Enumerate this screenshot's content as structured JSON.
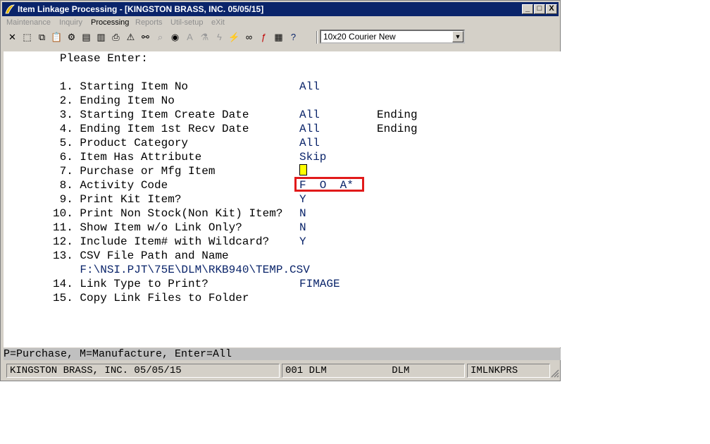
{
  "window": {
    "title": "Item Linkage Processing - [KINGSTON BRASS, INC. 05/05/15]",
    "controls": [
      "_",
      "□",
      "X"
    ]
  },
  "menu": [
    {
      "label": "Maintenance",
      "active": false
    },
    {
      "label": "Inquiry",
      "active": false
    },
    {
      "label": "Processing",
      "active": true
    },
    {
      "label": "Reports",
      "active": false
    },
    {
      "label": "Util-setup",
      "active": false
    },
    {
      "label": "eXit",
      "active": false
    }
  ],
  "toolbar": {
    "icons": [
      {
        "name": "close-icon",
        "glyph": "✕"
      },
      {
        "name": "select-icon",
        "glyph": "⬚"
      },
      {
        "name": "copy-icon",
        "glyph": "⧉"
      },
      {
        "name": "paste-icon",
        "glyph": "📋"
      },
      {
        "name": "gear-icon",
        "glyph": "⚙"
      },
      {
        "name": "print-setup-icon",
        "glyph": "▤"
      },
      {
        "name": "document-icon",
        "glyph": "▥"
      },
      {
        "name": "printer-icon",
        "glyph": "⎙"
      },
      {
        "name": "warning-icon",
        "glyph": "⚠"
      },
      {
        "name": "binoculars-icon",
        "glyph": "⚯"
      },
      {
        "name": "magnifier-icon",
        "glyph": "⌕"
      },
      {
        "name": "globe-icon",
        "glyph": "◉"
      },
      {
        "name": "font-icon",
        "glyph": "A"
      },
      {
        "name": "wizard-icon",
        "glyph": "⚗"
      },
      {
        "name": "lightning-icon",
        "glyph": "ϟ"
      },
      {
        "name": "macro-icon",
        "glyph": "⚡"
      },
      {
        "name": "link-icon",
        "glyph": "∞"
      },
      {
        "name": "function-icon",
        "glyph": "ƒ"
      },
      {
        "name": "calculator-icon",
        "glyph": "▦"
      },
      {
        "name": "help-icon",
        "glyph": "?"
      }
    ],
    "font_selector": "10x20 Courier New"
  },
  "form": {
    "heading": "Please Enter:",
    "items": [
      {
        "label": " 1. Starting Item No",
        "value": "All",
        "extra": ""
      },
      {
        "label": " 2. Ending Item No",
        "value": "",
        "extra": ""
      },
      {
        "label": " 3. Starting Item Create Date",
        "value": "All",
        "extra": "Ending"
      },
      {
        "label": " 4. Ending Item 1st Recv Date",
        "value": "All",
        "extra": "Ending"
      },
      {
        "label": " 5. Product Category",
        "value": "All",
        "extra": ""
      },
      {
        "label": " 6. Item Has Attribute",
        "value": "Skip",
        "extra": ""
      },
      {
        "label": " 7. Purchase or Mfg Item",
        "value": "",
        "extra": ""
      },
      {
        "label": " 8. Activity Code",
        "value": "F  O  A*",
        "extra": ""
      },
      {
        "label": " 9. Print Kit Item?",
        "value": "Y",
        "extra": ""
      },
      {
        "label": "10. Print Non Stock(Non Kit) Item?",
        "value": "N",
        "extra": ""
      },
      {
        "label": "11. Show Item w/o Link Only?",
        "value": "N",
        "extra": ""
      },
      {
        "label": "12. Include Item# with Wildcard?",
        "value": "Y",
        "extra": ""
      },
      {
        "label": "13. CSV File Path and Name",
        "value": "",
        "extra": ""
      },
      {
        "label": "    F:\\NSI.PJT\\75E\\DLM\\RKB940\\TEMP.CSV",
        "value": "",
        "extra": ""
      },
      {
        "label": "14. Link Type to Print?",
        "value": "FIMAGE",
        "extra": ""
      },
      {
        "label": "15. Copy Link Files to Folder",
        "value": "",
        "extra": ""
      }
    ]
  },
  "hint": "P=Purchase, M=Manufacture, Enter=All",
  "status": {
    "company": "KINGSTON BRASS, INC. 05/05/15",
    "user": "001 DLM           DLM",
    "program": "IMLNKPRS"
  },
  "colors": {
    "titlebar": "#0a246a",
    "value_text": "#0a246a",
    "highlight_box": "#e11a1a",
    "cursor": "#ffff00"
  }
}
